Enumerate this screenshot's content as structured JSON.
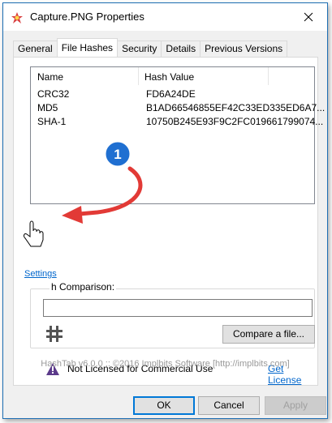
{
  "window": {
    "title": "Capture.PNG Properties"
  },
  "tabs": [
    "General",
    "File Hashes",
    "Security",
    "Details",
    "Previous Versions"
  ],
  "active_tab": "File Hashes",
  "list": {
    "headers": [
      "Name",
      "Hash Value"
    ],
    "rows": [
      {
        "name": "CRC32",
        "value": "FD6A24DE"
      },
      {
        "name": "MD5",
        "value": "B1AD66546855EF42C33ED335ED6A7..."
      },
      {
        "name": "SHA-1",
        "value": "10750B245E93F9C2FC019661799074..."
      }
    ]
  },
  "settings_link": "Settings",
  "comparison": {
    "label": "h Comparison:",
    "input_value": "",
    "compare_button": "Compare a file..."
  },
  "license": {
    "text": "Not Licensed for Commercial Use",
    "link": "Get License"
  },
  "footer": "HashTab v6.0.0 :: ©2016 Implbits Software [http://implbits.com]",
  "buttons": {
    "ok": "OK",
    "cancel": "Cancel",
    "apply": "Apply"
  },
  "annotation": {
    "badge": "1"
  },
  "colors": {
    "accent": "#0078d7",
    "link": "#0066cc",
    "arrow": "#e23a36",
    "badge": "#1f6fd1"
  }
}
